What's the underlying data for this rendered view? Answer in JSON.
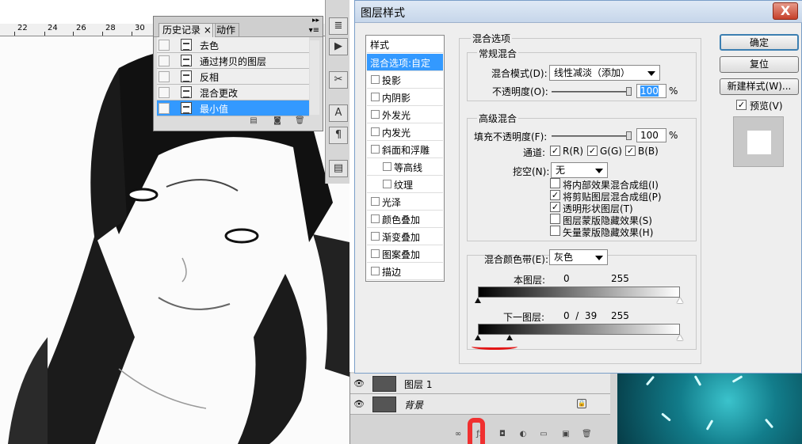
{
  "ruler": {
    "numbers": [
      "22",
      "24",
      "26",
      "28",
      "30"
    ]
  },
  "history_panel": {
    "tabs": [
      "历史记录",
      "动作"
    ],
    "tab_close": "×",
    "items": [
      "去色",
      "通过拷贝的图层",
      "反相",
      "混合更改",
      "最小值"
    ],
    "selected_index": 4
  },
  "layers_panel": {
    "layers": [
      {
        "name": "图层 1",
        "italic": false
      },
      {
        "name": "背景",
        "italic": true
      }
    ]
  },
  "dialog": {
    "title": "图层样式",
    "close_label": "X",
    "styles_header": "样式",
    "styles": [
      {
        "label": "混合选项:自定",
        "selected": true,
        "checkbox": false,
        "sub": false
      },
      {
        "label": "投影",
        "checkbox": true,
        "sub": false
      },
      {
        "label": "内阴影",
        "checkbox": true,
        "sub": false
      },
      {
        "label": "外发光",
        "checkbox": true,
        "sub": false
      },
      {
        "label": "内发光",
        "checkbox": true,
        "sub": false
      },
      {
        "label": "斜面和浮雕",
        "checkbox": true,
        "sub": false
      },
      {
        "label": "等高线",
        "checkbox": true,
        "sub": true
      },
      {
        "label": "纹理",
        "checkbox": true,
        "sub": true
      },
      {
        "label": "光泽",
        "checkbox": true,
        "sub": false
      },
      {
        "label": "颜色叠加",
        "checkbox": true,
        "sub": false
      },
      {
        "label": "渐变叠加",
        "checkbox": true,
        "sub": false
      },
      {
        "label": "图案叠加",
        "checkbox": true,
        "sub": false
      },
      {
        "label": "描边",
        "checkbox": true,
        "sub": false
      }
    ],
    "blend_options": {
      "title": "混合选项",
      "general": {
        "title": "常规混合",
        "blend_mode_label": "混合模式(D):",
        "blend_mode_value": "线性减淡（添加）",
        "opacity_label": "不透明度(O):",
        "opacity_value": "100",
        "percent": "%"
      },
      "advanced": {
        "title": "高级混合",
        "fill_opacity_label": "填充不透明度(F):",
        "fill_opacity_value": "100",
        "percent": "%",
        "channels_label": "通道:",
        "channels": [
          "R(R)",
          "G(G)",
          "B(B)"
        ],
        "knockout_label": "挖空(N):",
        "knockout_value": "无",
        "options": [
          {
            "label": "将内部效果混合成组(I)",
            "checked": false
          },
          {
            "label": "将剪贴图层混合成组(P)",
            "checked": true
          },
          {
            "label": "透明形状图层(T)",
            "checked": true
          },
          {
            "label": "图层蒙版隐藏效果(S)",
            "checked": false
          },
          {
            "label": "矢量蒙版隐藏效果(H)",
            "checked": false
          }
        ]
      },
      "blend_if": {
        "label": "混合颜色带(E):",
        "value": "灰色",
        "this_layer_label": "本图层:",
        "this_layer_low": "0",
        "this_layer_high": "255",
        "underlying_label": "下一图层:",
        "underlying_values": "0  /  39",
        "underlying_high": "255"
      }
    },
    "buttons": {
      "ok": "确定",
      "reset": "复位",
      "new_style": "新建样式(W)...",
      "preview_label": "预览(V)"
    }
  },
  "colors": {
    "selection": "#3399ff",
    "annotation": "#e31616"
  }
}
